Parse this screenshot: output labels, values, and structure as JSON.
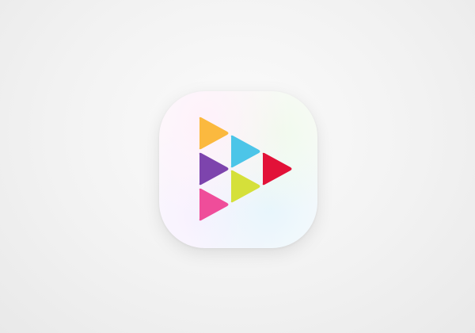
{
  "app_icon": {
    "icon_name": "colorful-play-triangles-icon",
    "colors": {
      "triangle_orange": "#fbb93f",
      "triangle_cyan": "#4cc5e8",
      "triangle_purple": "#7d44ad",
      "triangle_red": "#e21238",
      "triangle_pink": "#ef4d9a",
      "triangle_lime": "#d5e03a"
    }
  }
}
